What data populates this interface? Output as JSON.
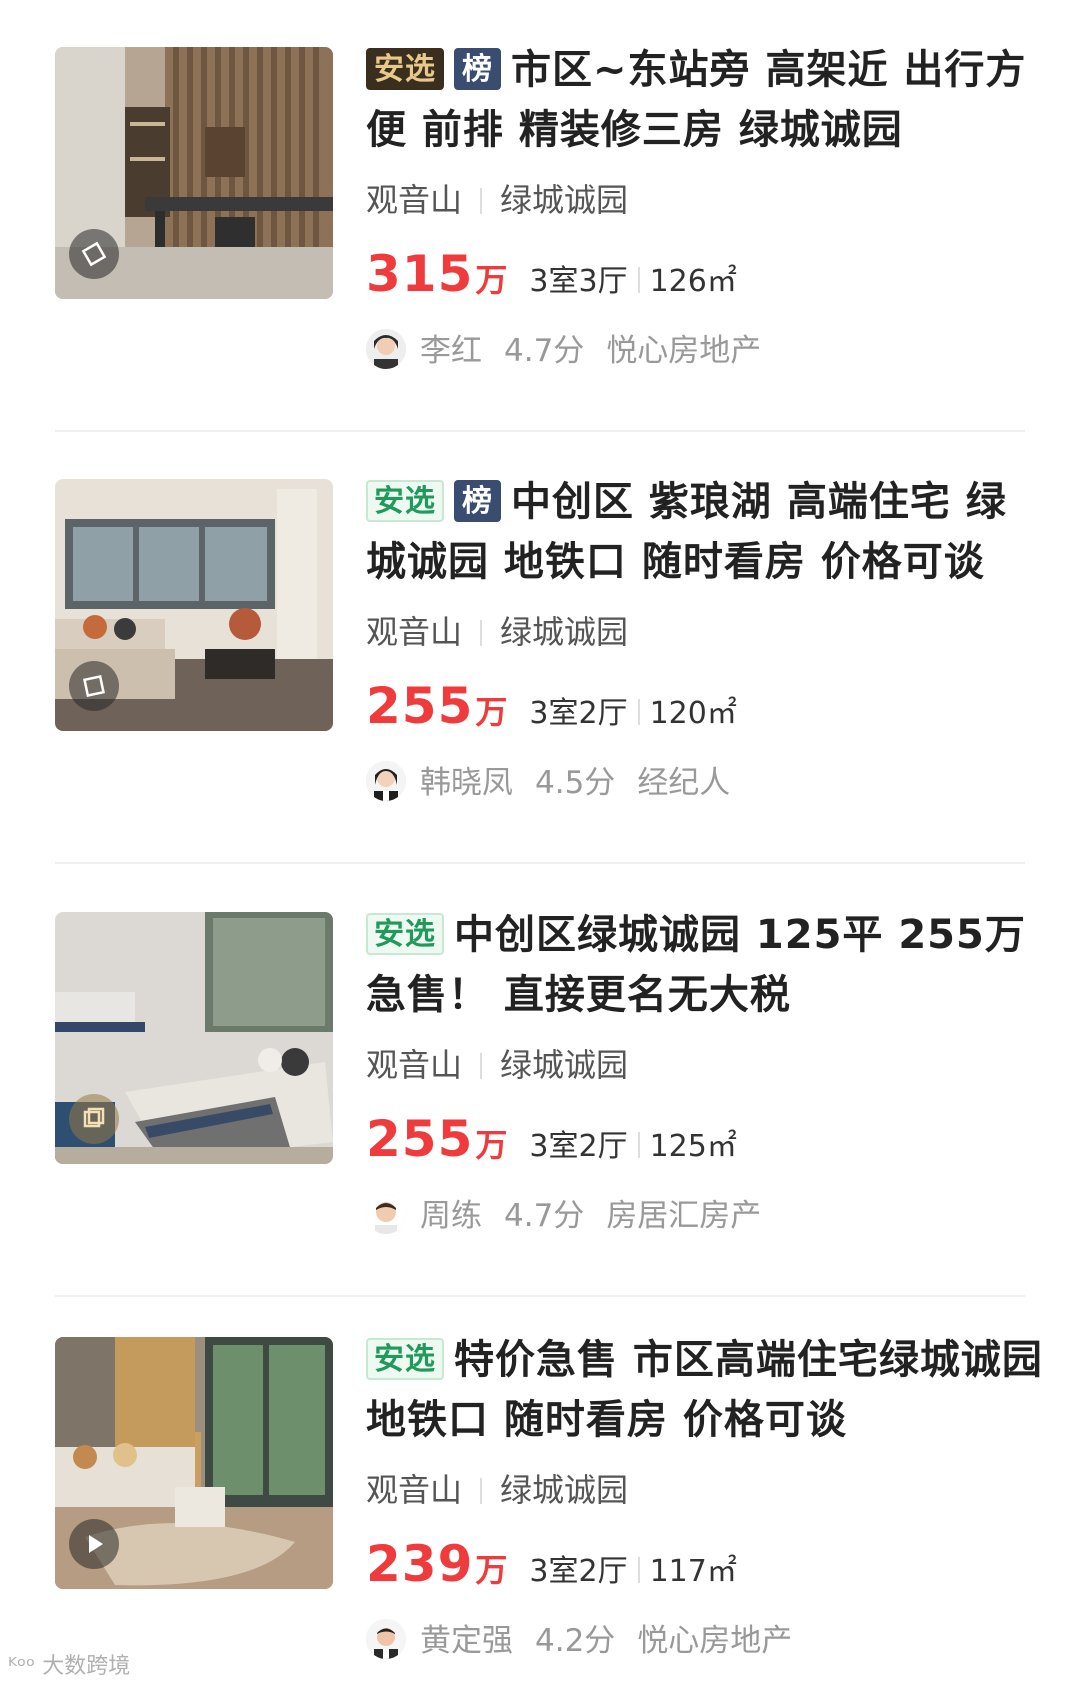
{
  "listings": [
    {
      "tags": [
        "安选",
        "榜"
      ],
      "title": "市区~东站旁 高架近 出行方便 前排 精装修三房 绿城诚园",
      "district": "观音山",
      "community": "绿城诚园",
      "price": "315",
      "price_unit": "万",
      "layout": "3室3厅",
      "area": "126㎡",
      "agent": "李红",
      "score": "4.7分",
      "agency": "悦心房地产",
      "media_icon": "vr-icon"
    },
    {
      "tags": [
        "安选",
        "榜"
      ],
      "title": "中创区 紫琅湖 高端住宅 绿城诚园 地铁口 随时看房 价格可谈",
      "district": "观音山",
      "community": "绿城诚园",
      "price": "255",
      "price_unit": "万",
      "layout": "3室2厅",
      "area": "120㎡",
      "agent": "韩晓凤",
      "score": "4.5分",
      "agency": "经纪人",
      "media_icon": "vr-icon"
    },
    {
      "tags": [
        "安选"
      ],
      "title": "中创区绿城诚园 125平 255万急售！ 直接更名无大税",
      "district": "观音山",
      "community": "绿城诚园",
      "price": "255",
      "price_unit": "万",
      "layout": "3室2厅",
      "area": "125㎡",
      "agent": "周练",
      "score": "4.7分",
      "agency": "房居汇房产",
      "media_icon": "vr-icon"
    },
    {
      "tags": [
        "安选"
      ],
      "title": "特价急售 市区高端住宅绿城诚园 地铁口 随时看房 价格可谈",
      "district": "观音山",
      "community": "绿城诚园",
      "price": "239",
      "price_unit": "万",
      "layout": "3室2厅",
      "area": "117㎡",
      "agent": "黄定强",
      "score": "4.2分",
      "agency": "悦心房地产",
      "media_icon": "play-icon"
    }
  ],
  "watermark": "大数跨境"
}
